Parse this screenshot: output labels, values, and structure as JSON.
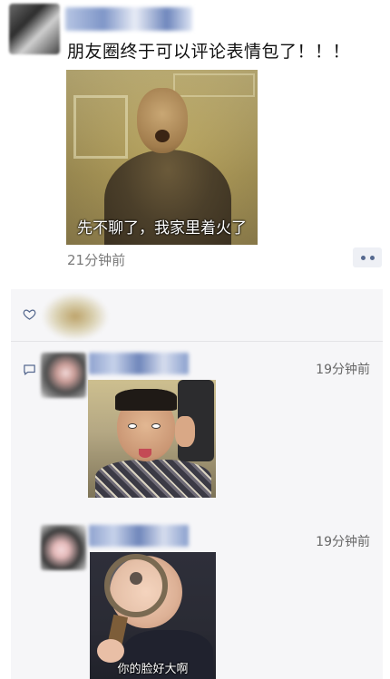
{
  "post": {
    "text": "朋友圈终于可以评论表情包了！！！",
    "image_caption": "先不聊了，我家里着火了",
    "time": "21分钟前"
  },
  "icons": {
    "more": "more-dots-icon",
    "like": "heart-icon",
    "comment": "comment-bubble-icon"
  },
  "colors": {
    "link_blue": "#56698f",
    "time_gray": "#7a7a7a",
    "panel_bg": "#f6f6f8"
  },
  "comments": [
    {
      "time": "19分钟前"
    },
    {
      "time": "19分钟前",
      "sticker_caption": "你的脸好大啊"
    }
  ]
}
